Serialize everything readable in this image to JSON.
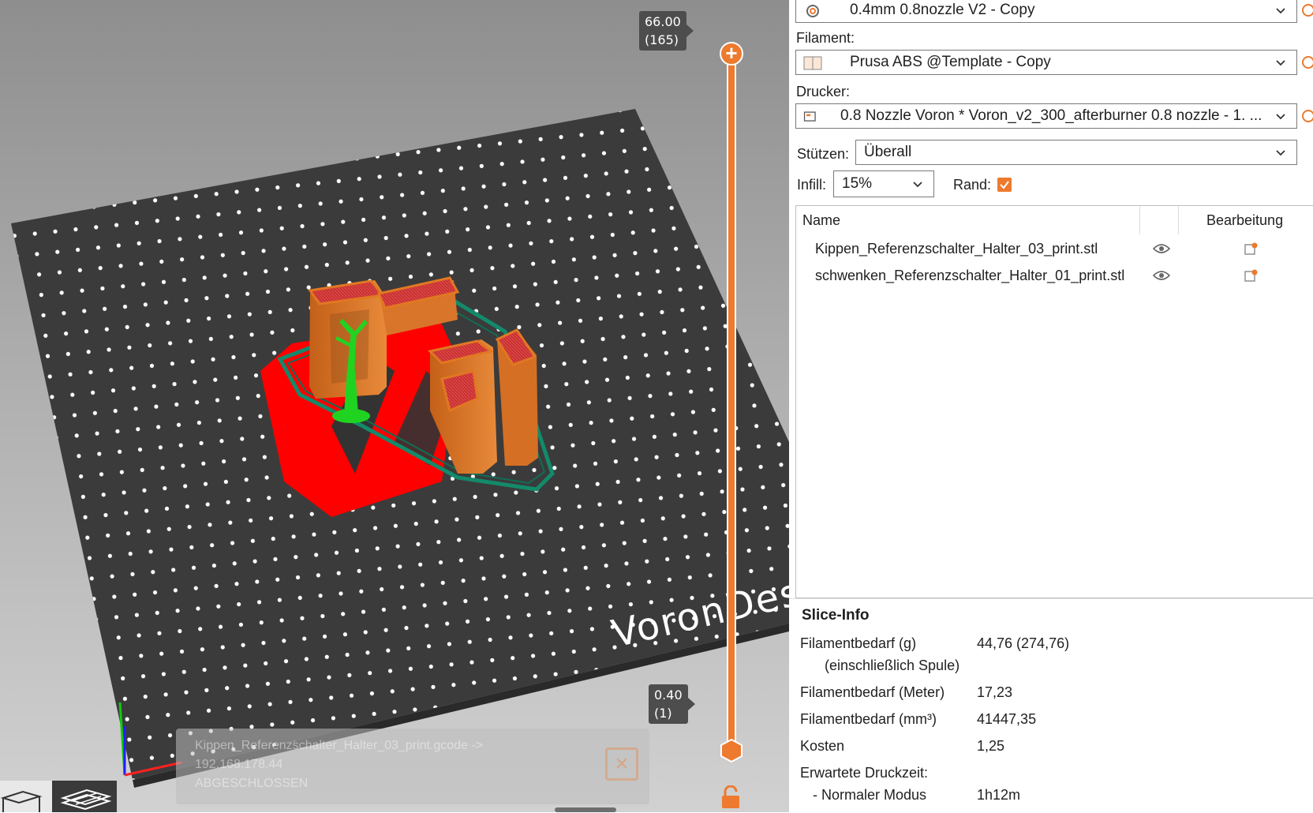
{
  "viewport": {
    "layer_top": {
      "height": "66.00",
      "layer": "(165)"
    },
    "layer_bottom": {
      "height": "0.40",
      "layer": "(1)"
    },
    "bed_logo": "VoronDesi",
    "notification": {
      "line1": "Kippen_Referenzschalter_Halter_03_print.gcode ->",
      "line2": "192.168.178.44",
      "line3": "ABGESCHLOSSEN"
    },
    "colors": {
      "accent": "#ed7a2e",
      "bed": "#3c3c3c",
      "perimeter": "#e07822",
      "infill": "#d83b3b",
      "support": "#21d321",
      "skirt": "#138a6a",
      "brim": "#ff0000"
    }
  },
  "settings": {
    "print_profile": "0.4mm 0.8nozzle V2 - Copy",
    "filament_label": "Filament:",
    "filament_value": "Prusa ABS @Template - Copy",
    "printer_label": "Drucker:",
    "printer_value": "0.8 Nozzle Voron  * Voron_v2_300_afterburner 0.8 nozzle - 1. ...",
    "supports_label": "Stützen:",
    "supports_value": "Überall",
    "infill_label": "Infill:",
    "infill_value": "15%",
    "brim_label": "Rand:",
    "brim_checked": true
  },
  "object_list": {
    "col_name": "Name",
    "col_edit": "Bearbeitung",
    "rows": [
      {
        "name": "Kippen_Referenzschalter_Halter_03_print.stl"
      },
      {
        "name": "schwenken_Referenzschalter_Halter_01_print.stl"
      }
    ]
  },
  "slice_info": {
    "title": "Slice-Info",
    "rows": [
      {
        "label": "Filamentbedarf (g)",
        "value": "44,76 (274,76)"
      },
      {
        "label": "(einschließlich Spule)",
        "value": ""
      },
      {
        "label": "Filamentbedarf (Meter)",
        "value": "17,23"
      },
      {
        "label": "Filamentbedarf (mm³)",
        "value": "41447,35"
      },
      {
        "label": "Kosten",
        "value": "1,25"
      },
      {
        "label": "Erwartete Druckzeit:",
        "value": ""
      },
      {
        "label": "- Normaler Modus",
        "value": "1h12m"
      }
    ]
  }
}
